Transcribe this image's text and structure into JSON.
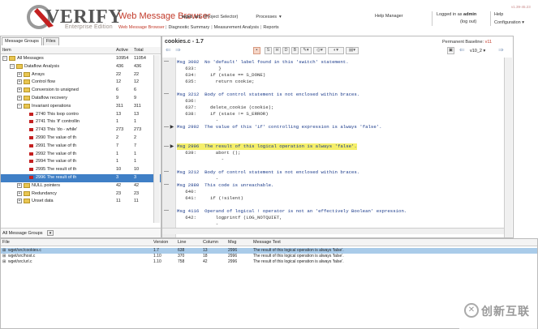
{
  "header": {
    "logo_word": "VERIFY",
    "logo_edition": "Enterprise Edition",
    "app_title": "Web Message Browser",
    "app_subtitle": "Web Message Browser",
    "project": "wget_src",
    "project_selector": "(Project Selector)",
    "processes": "Processes",
    "nav2": [
      "Diagnostic Summary",
      "Measurement Analysis",
      "Reports"
    ],
    "help_manager": "Help Manager",
    "logged_in_prefix": "Logged in as",
    "user": "admin",
    "logout": "(log out)",
    "help": "Help",
    "configuration": "Configuration",
    "version": "v1.39-45.23"
  },
  "left_panel": {
    "tabs": [
      "Message Groups",
      "Files"
    ],
    "col_item": "Item",
    "col_active": "Active",
    "col_total": "Total",
    "footer_label": "All Message Groups",
    "tree": [
      {
        "indent": 0,
        "kind": "folder",
        "exp": "−",
        "label": "All Messages",
        "active": "10954",
        "total": "11054"
      },
      {
        "indent": 1,
        "kind": "folder",
        "exp": "−",
        "label": "Dataflow Analysis",
        "active": "436",
        "total": "436"
      },
      {
        "indent": 2,
        "kind": "folder",
        "exp": "+",
        "label": "Arrays",
        "active": "22",
        "total": "22"
      },
      {
        "indent": 2,
        "kind": "folder",
        "exp": "+",
        "label": "Control flow",
        "active": "12",
        "total": "12"
      },
      {
        "indent": 2,
        "kind": "folder",
        "exp": "+",
        "label": "Conversion to unsigned",
        "active": "6",
        "total": "6"
      },
      {
        "indent": 2,
        "kind": "folder",
        "exp": "+",
        "label": "Dataflow recovery",
        "active": "9",
        "total": "9"
      },
      {
        "indent": 2,
        "kind": "folder",
        "exp": "−",
        "label": "Invariant operations",
        "active": "311",
        "total": "311"
      },
      {
        "indent": 3,
        "kind": "msg",
        "label": "2740 This loop contro",
        "active": "13",
        "total": "13"
      },
      {
        "indent": 3,
        "kind": "msg",
        "label": "2741 This 'if' controllin",
        "active": "1",
        "total": "1"
      },
      {
        "indent": 3,
        "kind": "msg",
        "label": "2743 This 'do - while'",
        "active": "273",
        "total": "273"
      },
      {
        "indent": 3,
        "kind": "msg",
        "label": "2990 The value of th",
        "active": "2",
        "total": "2"
      },
      {
        "indent": 3,
        "kind": "msg",
        "label": "2991 The value of th",
        "active": "7",
        "total": "7"
      },
      {
        "indent": 3,
        "kind": "msg",
        "label": "2992 The value of th",
        "active": "1",
        "total": "1"
      },
      {
        "indent": 3,
        "kind": "msg",
        "label": "2994 The value of th",
        "active": "1",
        "total": "1"
      },
      {
        "indent": 3,
        "kind": "msg",
        "label": "2995 The result of th",
        "active": "10",
        "total": "10"
      },
      {
        "indent": 3,
        "kind": "msg",
        "label": "2996 The result of th",
        "active": "3",
        "total": "3",
        "selected": true
      },
      {
        "indent": 2,
        "kind": "folder",
        "exp": "+",
        "label": "NULL pointers",
        "active": "42",
        "total": "42"
      },
      {
        "indent": 2,
        "kind": "folder",
        "exp": "+",
        "label": "Redundancy",
        "active": "23",
        "total": "23"
      },
      {
        "indent": 2,
        "kind": "folder",
        "exp": "+",
        "label": "Unset data",
        "active": "11",
        "total": "11"
      }
    ]
  },
  "code_panel": {
    "file_title": "cookies.c - 1.7",
    "baseline_label": "Permanent Baseline:",
    "baseline_value": "v11",
    "version_select": "v10_2",
    "lines": [
      {
        "t": "msg",
        "mark": "—",
        "text": "Msg 3002  No 'default' label found in this 'switch' statement."
      },
      {
        "t": "code",
        "text": "   633:        }"
      },
      {
        "t": "code",
        "text": "   634:     if (state == S_DONE)"
      },
      {
        "t": "code",
        "text": "   635:       return cookie;"
      },
      {
        "t": "blank",
        "text": ""
      },
      {
        "t": "msg",
        "mark": "—",
        "text": "Msg 3212  Body of control statement is not enclosed within braces."
      },
      {
        "t": "code",
        "text": "   636:"
      },
      {
        "t": "code",
        "text": "   637:     delete_cookie (cookie);"
      },
      {
        "t": "code",
        "text": "   638:     if (state != S_ERROR)"
      },
      {
        "t": "blank",
        "text": "              -"
      },
      {
        "t": "msg",
        "mark": "— ▶",
        "text": "Msg 2992  The value of this 'if' controlling expression is always 'false'."
      },
      {
        "t": "blank",
        "text": ""
      },
      {
        "t": "blank",
        "text": ""
      },
      {
        "t": "msg",
        "mark": "— ▶",
        "hl": true,
        "text": "Msg 2996  The result of this logical operation is always 'false'."
      },
      {
        "t": "code",
        "text": "   639:       abort ();"
      },
      {
        "t": "blank",
        "text": "                -"
      },
      {
        "t": "blank",
        "text": ""
      },
      {
        "t": "msg",
        "mark": "—",
        "text": "Msg 3212  Body of control statement is not enclosed within braces."
      },
      {
        "t": "blank",
        "text": "              -"
      },
      {
        "t": "msg",
        "mark": "—",
        "text": "Msg 2880  This code is unreachable."
      },
      {
        "t": "code",
        "text": "   640:"
      },
      {
        "t": "code",
        "text": "   641:     if (!silent)"
      },
      {
        "t": "blank",
        "text": ""
      },
      {
        "t": "msg",
        "mark": "—",
        "text": "Msg 4116  Operand of logical ! operator is not an 'effectively Boolean' expression."
      },
      {
        "t": "code",
        "text": "   642:       logprintf (LOG_NOTQUIET,"
      },
      {
        "t": "blank",
        "text": "              -"
      }
    ]
  },
  "bottom_table": {
    "headers": [
      "File",
      "Version",
      "Line",
      "Column",
      "Msg",
      "Message Text"
    ],
    "rows": [
      {
        "file": "wget/src/cookies.c",
        "version": "1.7",
        "line": "638",
        "column": "13",
        "msg": "2996",
        "text": "The result of this logical operation is always 'false'.",
        "selected": true
      },
      {
        "file": "wget/src/host.c",
        "version": "1.10",
        "line": "370",
        "column": "18",
        "msg": "2996",
        "text": "The result of this logical operation is always 'false'."
      },
      {
        "file": "wget/src/url.c",
        "version": "1.10",
        "line": "758",
        "column": "42",
        "msg": "2996",
        "text": "The result of this logical operation is always 'false'."
      }
    ]
  },
  "watermark": {
    "glyph": "✕",
    "text": "创新互联"
  }
}
